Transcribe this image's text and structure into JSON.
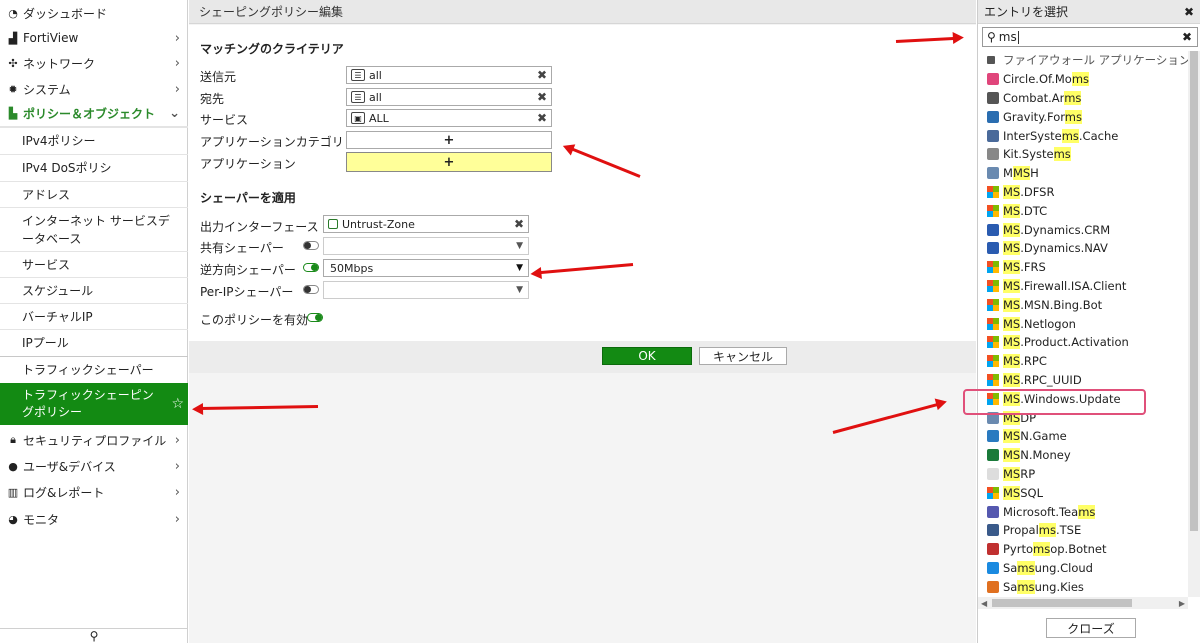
{
  "sidebar": {
    "items": [
      {
        "label": "ダッシュボード",
        "icon": "dashboard-icon"
      },
      {
        "label": "FortiView",
        "icon": "chart-icon"
      },
      {
        "label": "ネットワーク",
        "icon": "network-icon"
      },
      {
        "label": "システム",
        "icon": "gear-icon"
      },
      {
        "label": "ポリシー＆オブジェクト",
        "icon": "policy-icon"
      },
      {
        "label": "IPv4ポリシー"
      },
      {
        "label": "IPv4 DoSポリシ"
      },
      {
        "label": "アドレス"
      },
      {
        "label": "インターネット サービスデータベース"
      },
      {
        "label": "サービス"
      },
      {
        "label": "スケジュール"
      },
      {
        "label": "バーチャルIP"
      },
      {
        "label": "IPプール"
      },
      {
        "label": "トラフィックシェーパー"
      },
      {
        "label": "トラフィックシェーピングポリシー"
      },
      {
        "label": "セキュリティプロファイル",
        "icon": "lock-icon"
      },
      {
        "label": "ユーザ&デバイス",
        "icon": "user-icon"
      },
      {
        "label": "ログ&レポート",
        "icon": "log-icon"
      },
      {
        "label": "モニタ",
        "icon": "monitor-icon"
      }
    ]
  },
  "main": {
    "title": "シェーピングポリシー編集",
    "matching_section": "マッチングのクライテリア",
    "source_label": "送信元",
    "source_value": "all",
    "destination_label": "宛先",
    "destination_value": "all",
    "service_label": "サービス",
    "service_value": "ALL",
    "app_category_label": "アプリケーションカテゴリ",
    "application_label": "アプリケーション",
    "add_symbol": "+",
    "shaper_section": "シェーパーを適用",
    "out_interface_label": "出力インターフェース",
    "out_interface_value": "Untrust-Zone",
    "shared_shaper_label": "共有シェーパー",
    "reverse_shaper_label": "逆方向シェーパー",
    "reverse_shaper_value": "50Mbps",
    "perip_shaper_label": "Per-IPシェーパー",
    "enable_label": "このポリシーを有効",
    "ok_label": "OK",
    "cancel_label": "キャンセル"
  },
  "entry_panel": {
    "title": "エントリを選択",
    "close_glyph": "✖",
    "search_value": "ms",
    "group_label": "ファイアウォール アプリケーション",
    "close_label": "クローズ"
  },
  "entries": [
    {
      "pre": "Circle.Of.Mo",
      "hl": "ms",
      "post": "",
      "icon": "circle-of-moms-icon",
      "color": "#e0457b"
    },
    {
      "pre": "Combat.Ar",
      "hl": "ms",
      "post": "",
      "icon": "combat-arms-icon",
      "color": "#555"
    },
    {
      "pre": "Gravity.For",
      "hl": "ms",
      "post": "",
      "icon": "gravity-forms-icon",
      "color": "#2a6db0"
    },
    {
      "pre": "InterSyste",
      "hl": "ms",
      "post": ".Cache",
      "icon": "intersystems-icon",
      "color": "#4a6a9a"
    },
    {
      "pre": "Kit.Syste",
      "hl": "ms",
      "post": "",
      "icon": "kit-systems-icon",
      "color": "#888"
    },
    {
      "pre": "M",
      "hl": "MS",
      "post": "H",
      "icon": "file-icon",
      "color": "#6a8ab0"
    },
    {
      "pre": "",
      "hl": "MS",
      "post": ".DFSR",
      "icon": "microsoft-icon"
    },
    {
      "pre": "",
      "hl": "MS",
      "post": ".DTC",
      "icon": "microsoft-icon"
    },
    {
      "pre": "",
      "hl": "MS",
      "post": ".Dynamics.CRM",
      "icon": "dynamics-icon",
      "color": "#2a5bb0"
    },
    {
      "pre": "",
      "hl": "MS",
      "post": ".Dynamics.NAV",
      "icon": "dynamics-icon",
      "color": "#2a5bb0"
    },
    {
      "pre": "",
      "hl": "MS",
      "post": ".FRS",
      "icon": "microsoft-icon"
    },
    {
      "pre": "",
      "hl": "MS",
      "post": ".Firewall.ISA.Client",
      "icon": "microsoft-icon"
    },
    {
      "pre": "",
      "hl": "MS",
      "post": ".MSN.Bing.Bot",
      "icon": "microsoft-icon"
    },
    {
      "pre": "",
      "hl": "MS",
      "post": ".Netlogon",
      "icon": "microsoft-icon"
    },
    {
      "pre": "",
      "hl": "MS",
      "post": ".Product.Activation",
      "icon": "microsoft-icon"
    },
    {
      "pre": "",
      "hl": "MS",
      "post": ".RPC",
      "icon": "microsoft-icon"
    },
    {
      "pre": "",
      "hl": "MS",
      "post": ".RPC_UUID",
      "icon": "microsoft-icon"
    },
    {
      "pre": "",
      "hl": "MS",
      "post": ".Windows.Update",
      "icon": "microsoft-icon"
    },
    {
      "pre": "",
      "hl": "MS",
      "post": "DP",
      "icon": "file-icon",
      "color": "#6a8ab0"
    },
    {
      "pre": "",
      "hl": "MS",
      "post": "N.Game",
      "icon": "msn-game-icon",
      "color": "#2a7ac0"
    },
    {
      "pre": "",
      "hl": "MS",
      "post": "N.Money",
      "icon": "msn-money-icon",
      "color": "#1a7a3a"
    },
    {
      "pre": "",
      "hl": "MS",
      "post": "RP",
      "icon": "blank-icon",
      "color": "#ddd"
    },
    {
      "pre": "",
      "hl": "MS",
      "post": "SQL",
      "icon": "microsoft-icon"
    },
    {
      "pre": "Microsoft.Tea",
      "hl": "ms",
      "post": "",
      "icon": "teams-icon",
      "color": "#5558af"
    },
    {
      "pre": "Propal",
      "hl": "ms",
      "post": ".TSE",
      "icon": "propalms-icon",
      "color": "#3a5a8a"
    },
    {
      "pre": "Pyrto",
      "hl": "ms",
      "post": "op.Botnet",
      "icon": "botnet-icon",
      "color": "#c03030"
    },
    {
      "pre": "Sa",
      "hl": "ms",
      "post": "ung.Cloud",
      "icon": "samsung-cloud-icon",
      "color": "#1a8ae0"
    },
    {
      "pre": "Sa",
      "hl": "ms",
      "post": "ung.Kies",
      "icon": "samsung-kies-icon",
      "color": "#e07020"
    }
  ]
}
